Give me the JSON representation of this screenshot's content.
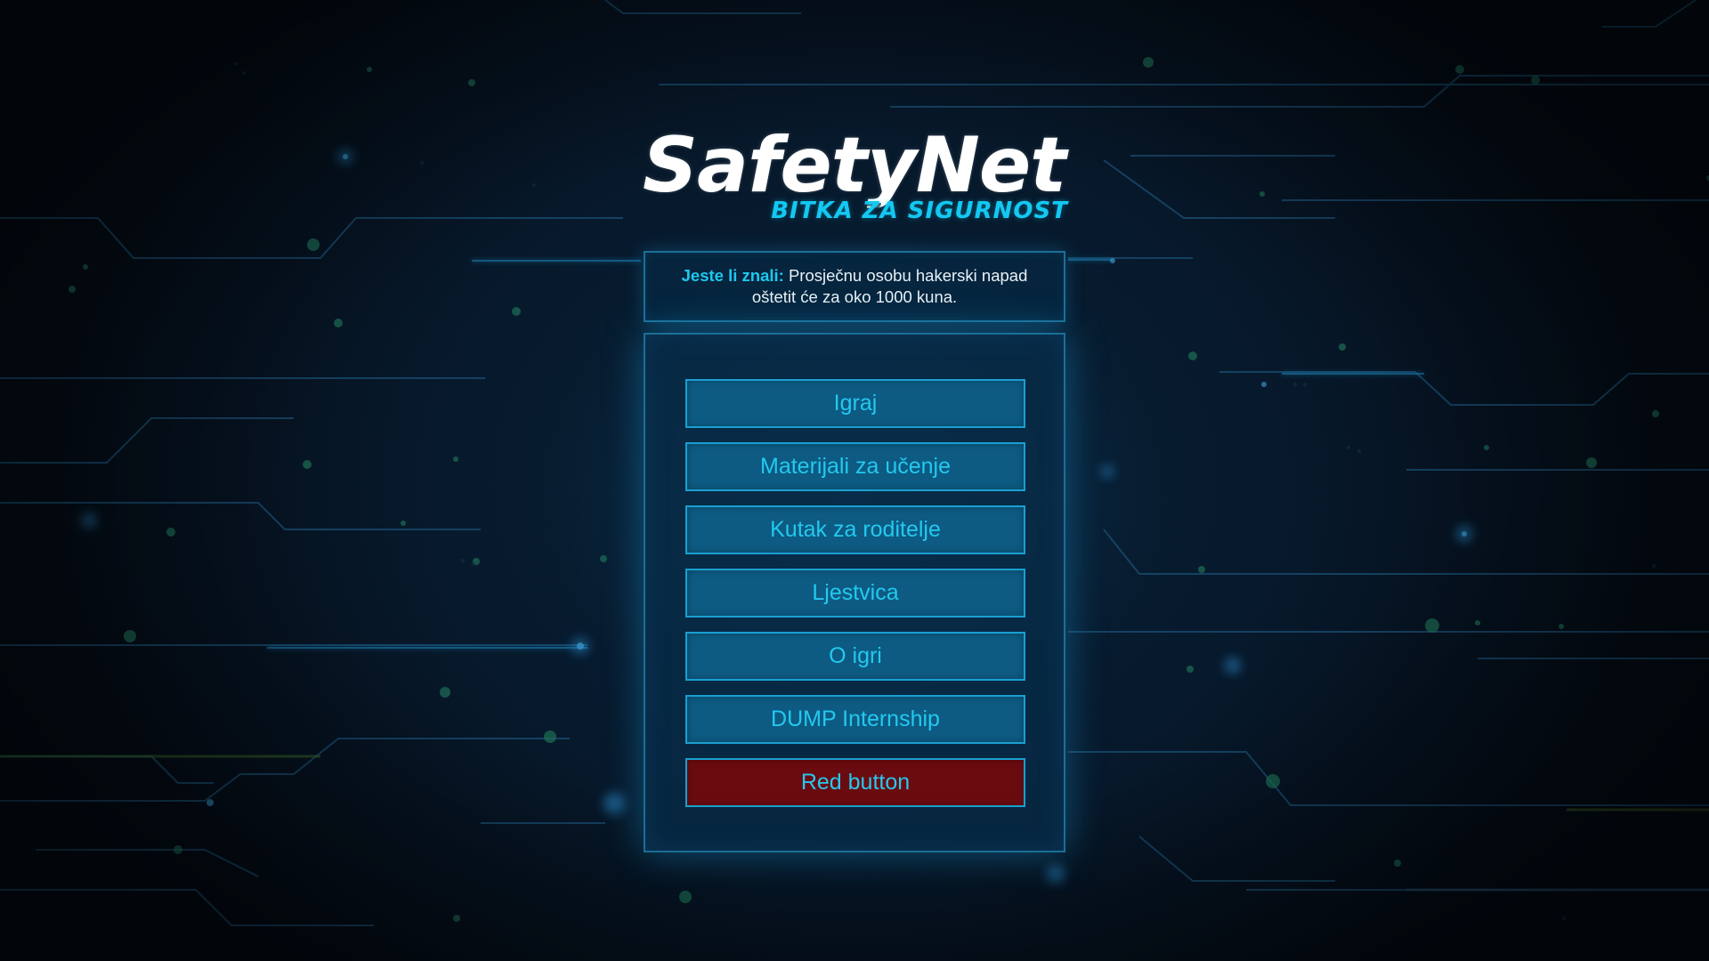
{
  "logo": {
    "title": "SafetyNet",
    "subtitle": "BITKA ZA SIGURNOST"
  },
  "fact": {
    "label": "Jeste li znali:",
    "text": "Prosječnu osobu hakerski napad oštetit će za oko 1000 kuna."
  },
  "menu": {
    "items": [
      {
        "label": "Igraj"
      },
      {
        "label": "Materijali za učenje"
      },
      {
        "label": "Kutak za roditelje"
      },
      {
        "label": "Ljestvica"
      },
      {
        "label": "O igri"
      },
      {
        "label": "DUMP Internship"
      },
      {
        "label": "Red button"
      }
    ]
  },
  "colors": {
    "accent": "#23c9ef",
    "button_bg": "#0d5a82",
    "red_button_bg": "#6a0b10",
    "background": "#07182a"
  }
}
